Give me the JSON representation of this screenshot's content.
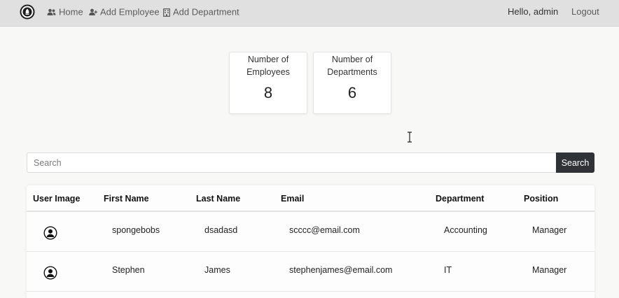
{
  "nav": {
    "home": "Home",
    "add_employee": "Add Employee",
    "add_department": "Add Department",
    "greeting": "Hello, admin",
    "logout": "Logout"
  },
  "stats": [
    {
      "label": "Number of Employees",
      "value": "8"
    },
    {
      "label": "Number of Departments",
      "value": "6"
    }
  ],
  "search": {
    "placeholder": "Search",
    "value": "",
    "button_label": "Search"
  },
  "table": {
    "headers": [
      "User Image",
      "First Name",
      "Last Name",
      "Email",
      "Department",
      "Position"
    ],
    "rows": [
      {
        "first_name": "spongebobs",
        "last_name": "dsadasd",
        "email": "scccc@email.com",
        "department": "Accounting",
        "position": "Manager"
      },
      {
        "first_name": "Stephen",
        "last_name": "James",
        "email": "stephenjames@email.com",
        "department": "IT",
        "position": "Manager"
      }
    ]
  },
  "icons": {
    "logo": "logo-icon",
    "home": "users-icon",
    "add_employee": "user-plus-icon",
    "add_department": "building-icon",
    "avatar": "user-circle-icon",
    "cursor": "text-cursor-icon"
  },
  "colors": {
    "navbar_bg": "#e0e0e0",
    "search_button_bg": "#2f3338",
    "page_bg": "#f8f8f7"
  }
}
